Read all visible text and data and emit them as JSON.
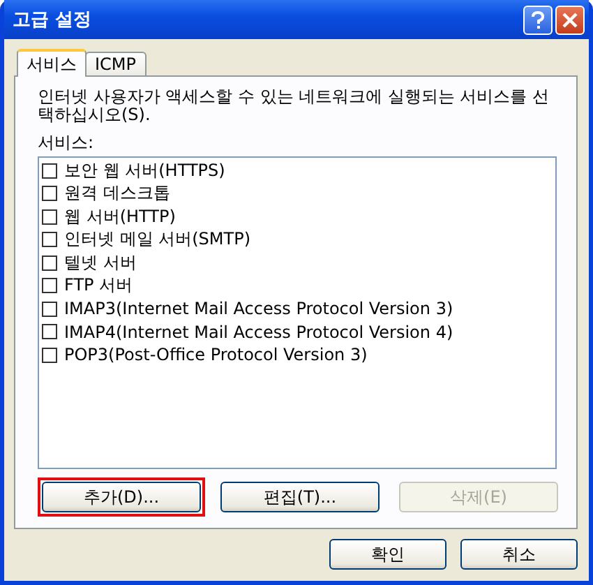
{
  "window": {
    "title": "고급 설정"
  },
  "tabs": [
    {
      "label": "서비스",
      "selected": true
    },
    {
      "label": "ICMP",
      "selected": false
    }
  ],
  "description": "인터넷 사용자가 액세스할 수 있는 네트워크에 실행되는 서비스를 선택하십시오(S).",
  "services_label": "서비스:",
  "services": [
    {
      "label": "보안 웹 서버(HTTPS)",
      "checked": false
    },
    {
      "label": "원격 데스크톱",
      "checked": false
    },
    {
      "label": "웹 서버(HTTP)",
      "checked": false
    },
    {
      "label": "인터넷 메일 서버(SMTP)",
      "checked": false
    },
    {
      "label": "텔넷 서버",
      "checked": false
    },
    {
      "label": "FTP 서버",
      "checked": false
    },
    {
      "label": "IMAP3(Internet Mail Access Protocol Version 3)",
      "checked": false
    },
    {
      "label": "IMAP4(Internet Mail Access Protocol Version 4)",
      "checked": false
    },
    {
      "label": "POP3(Post-Office Protocol Version 3)",
      "checked": false
    }
  ],
  "list_buttons": [
    {
      "label": "추가(D)...",
      "disabled": false,
      "highlighted": true
    },
    {
      "label": "편집(T)...",
      "disabled": false,
      "highlighted": false
    },
    {
      "label": "삭제(E)",
      "disabled": true,
      "highlighted": false
    }
  ],
  "buttons": [
    {
      "label": "확인"
    },
    {
      "label": "취소"
    }
  ]
}
